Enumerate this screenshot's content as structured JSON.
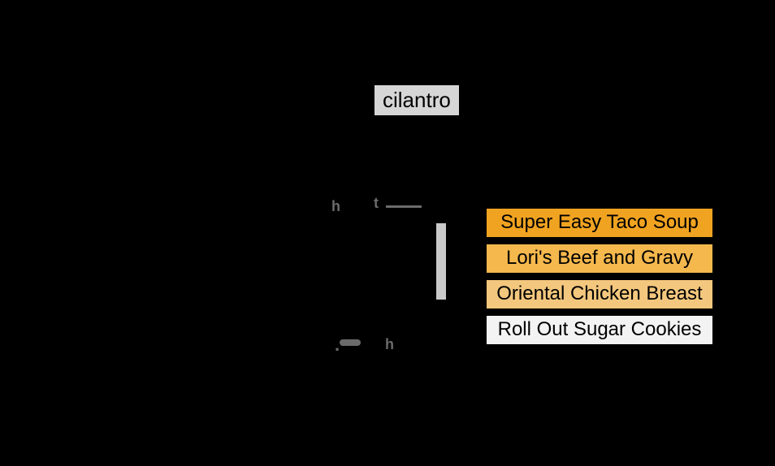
{
  "query": {
    "text": "cilantro",
    "bg": "#d6d6d6"
  },
  "recipes": [
    {
      "label": "Super Easy Taco Soup",
      "bg": "#f0a321"
    },
    {
      "label": "Lori's Beef and Gravy",
      "bg": "#f5b84d"
    },
    {
      "label": "Oriental Chicken Breast",
      "bg": "#f3c77d"
    },
    {
      "label": "Roll Out Sugar Cookies",
      "bg": "#f3f3f3"
    }
  ],
  "ticks": {
    "t1": "h",
    "t2": "t",
    "t3": ".",
    "t4": "h"
  }
}
